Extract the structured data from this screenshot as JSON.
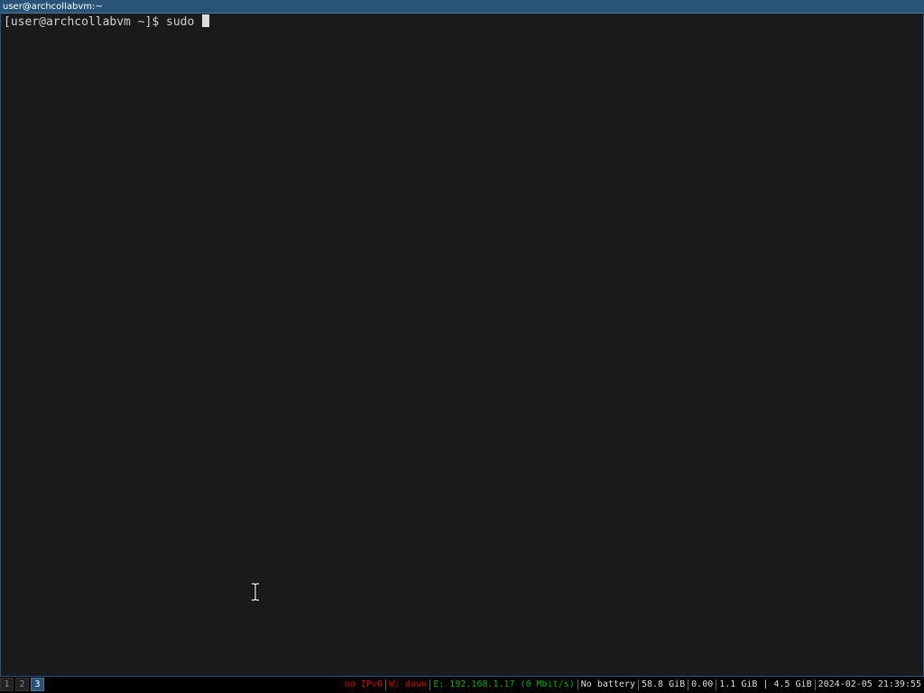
{
  "window": {
    "title": "user@archcollabvm:~"
  },
  "terminal": {
    "prompt": "[user@archcollabvm ~]$ ",
    "command": "sudo "
  },
  "workspaces": [
    {
      "label": "1",
      "focused": false
    },
    {
      "label": "2",
      "focused": false
    },
    {
      "label": "3",
      "focused": true
    }
  ],
  "status": {
    "ipv6": "no IPv6",
    "wireless": "W: down",
    "ethernet": "E: 192.168.1.17 (0 Mbit/s)",
    "battery": "No battery",
    "disk": "58.8 GiB",
    "load": "0.00",
    "memory": "1.1 GiB | 4.5 GiB",
    "datetime": "2024-02-05 21:39:55"
  },
  "colors": {
    "focused_border": "#285577",
    "terminal_bg": "#1a1a1a",
    "status_bad": "#cc0000",
    "status_good": "#00aa00",
    "status_text": "#dddddd"
  },
  "icons": {
    "mouse_cursor": "ibeam-cursor-icon"
  }
}
